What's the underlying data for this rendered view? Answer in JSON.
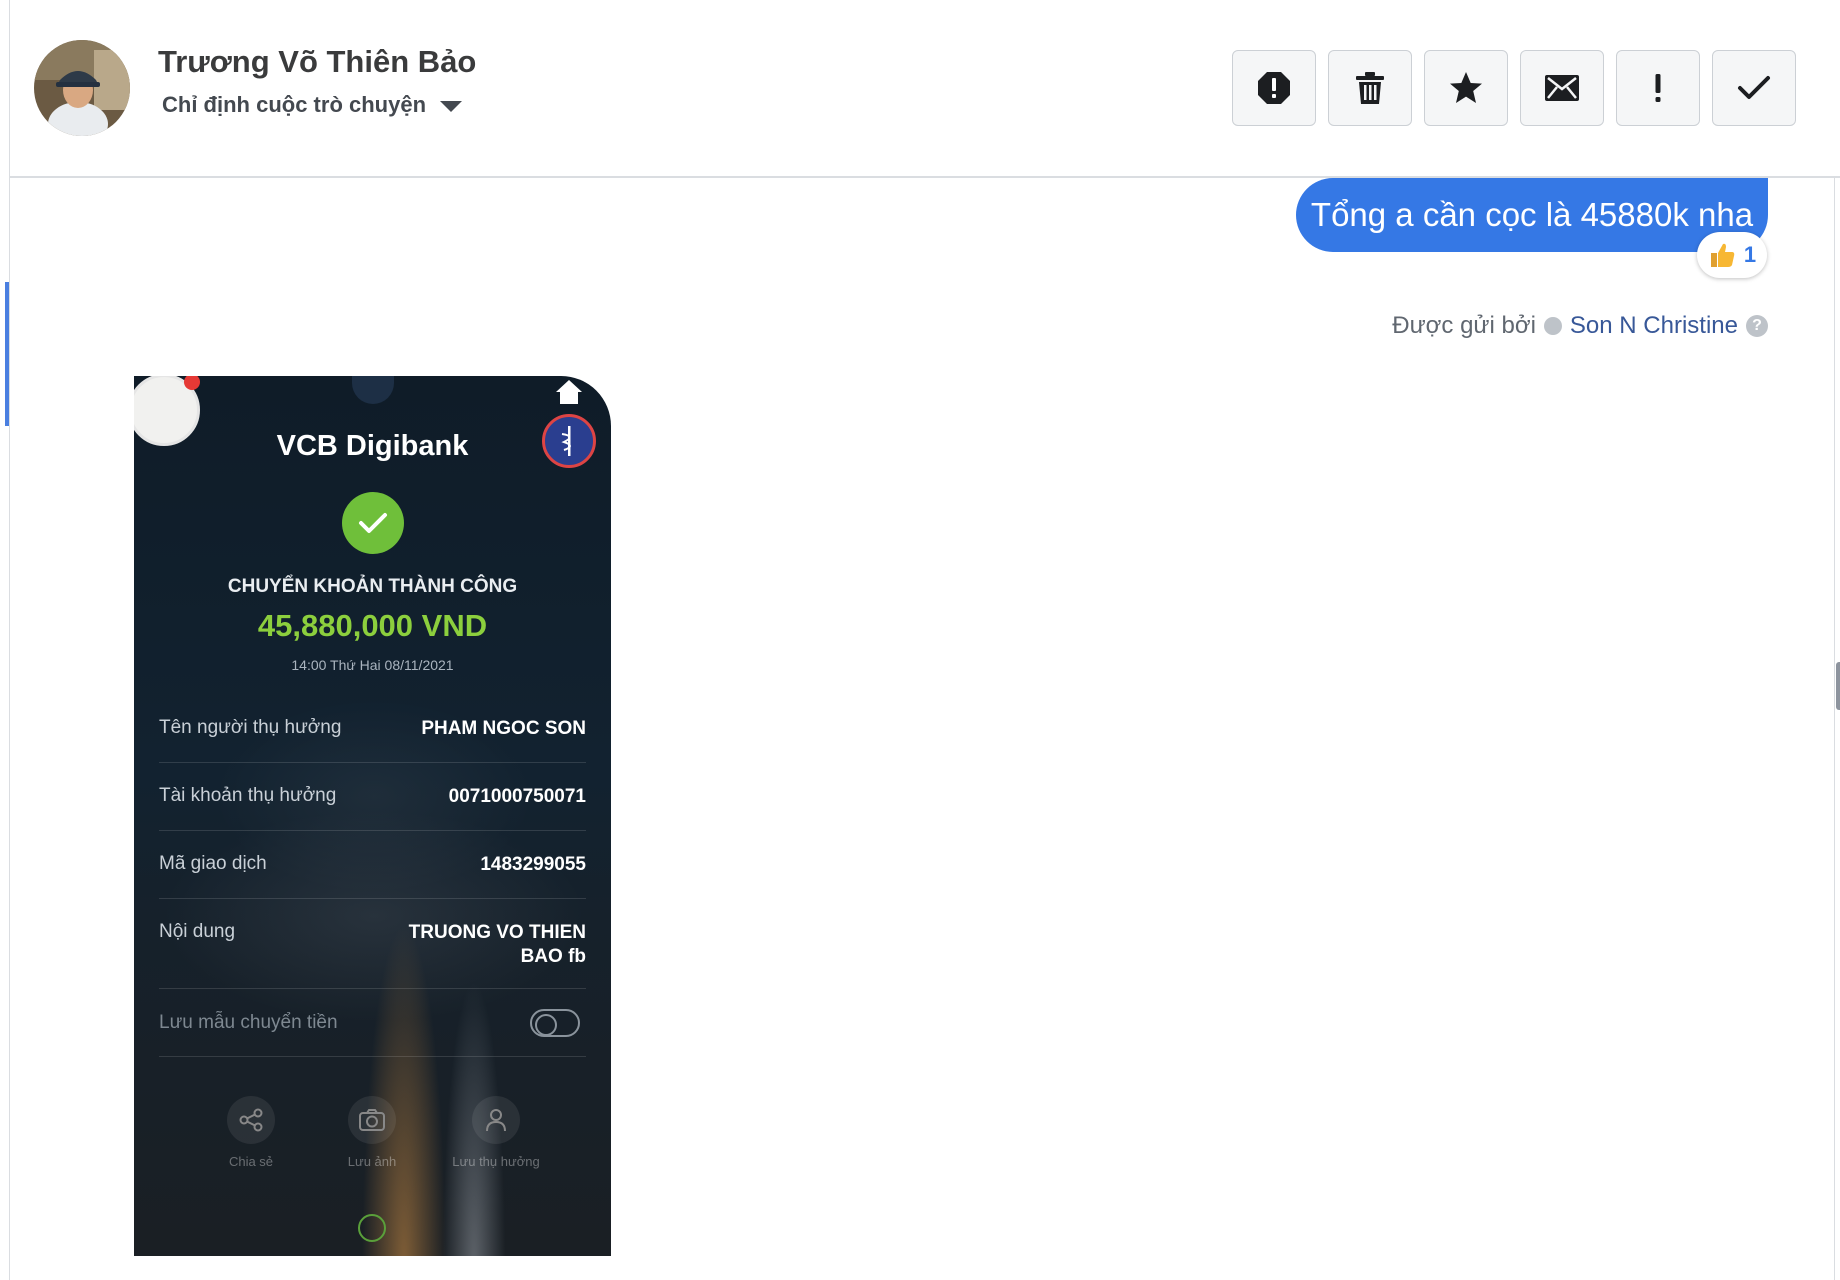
{
  "header": {
    "contact_name": "Trương Võ Thiên Bảo",
    "assign_label": "Chỉ định cuộc trò chuyện",
    "toolbar": [
      {
        "name": "report-button",
        "icon": "alert-octagon-icon"
      },
      {
        "name": "delete-button",
        "icon": "trash-icon"
      },
      {
        "name": "star-button",
        "icon": "star-icon"
      },
      {
        "name": "mark-unread-button",
        "icon": "envelope-icon"
      },
      {
        "name": "important-button",
        "icon": "exclamation-icon"
      },
      {
        "name": "done-button",
        "icon": "checkmark-icon"
      }
    ]
  },
  "conversation": {
    "outgoing_message": "Tổng a cần cọc là 45880k nha",
    "reaction": {
      "icon": "thumbs-up-icon",
      "count": "1"
    },
    "sent_by_label": "Được gửi bởi",
    "sent_by_author": "Son N Christine"
  },
  "attachment": {
    "app_title": "VCB Digibank",
    "status": "CHUYỂN KHOẢN THÀNH CÔNG",
    "amount": "45,880,000 VND",
    "datetime": "14:00 Thứ Hai 08/11/2021",
    "rows": [
      {
        "label": "Tên người thụ hưởng",
        "value": "PHAM NGOC SON"
      },
      {
        "label": "Tài khoản thụ hưởng",
        "value": "0071000750071"
      },
      {
        "label": "Mã giao dịch",
        "value": "1483299055"
      },
      {
        "label": "Nội dung",
        "value_line1": "TRUONG VO THIEN",
        "value_line2": "BAO fb"
      }
    ],
    "save_template_label": "Lưu mẫu chuyển tiền",
    "actions": [
      {
        "label": "Chia sẻ",
        "icon": "share-icon"
      },
      {
        "label": "Lưu ảnh",
        "icon": "camera-icon"
      },
      {
        "label": "Lưu thụ hưởng",
        "icon": "person-icon"
      }
    ]
  },
  "colors": {
    "accent_blue": "#3578e5",
    "author_link": "#385898",
    "success_green": "#6fbf3a",
    "amount_green": "#8ccf3d"
  }
}
